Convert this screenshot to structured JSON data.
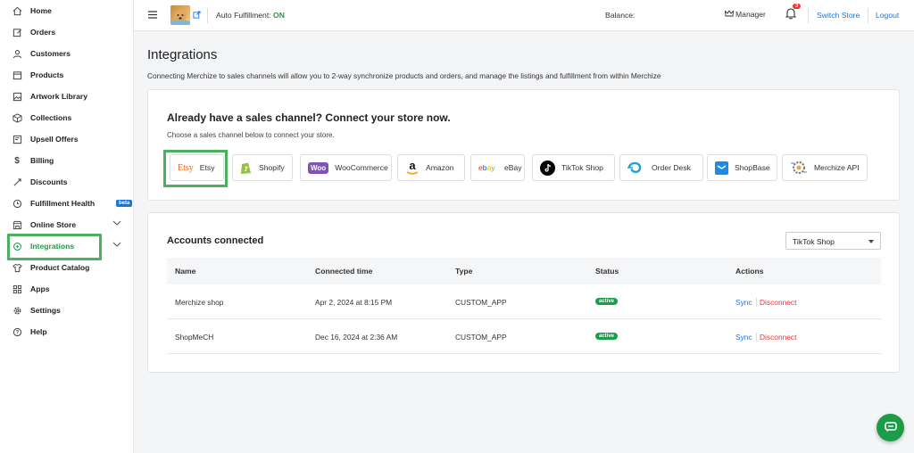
{
  "sidebar": {
    "items": [
      {
        "label": "Home",
        "icon": "home-icon"
      },
      {
        "label": "Orders",
        "icon": "edit-icon"
      },
      {
        "label": "Customers",
        "icon": "user-icon"
      },
      {
        "label": "Products",
        "icon": "box-icon"
      },
      {
        "label": "Artwork Library",
        "icon": "image-icon"
      },
      {
        "label": "Collections",
        "icon": "cube-icon"
      },
      {
        "label": "Upsell Offers",
        "icon": "offer-icon"
      },
      {
        "label": "Billing",
        "icon": "dollar-icon"
      },
      {
        "label": "Discounts",
        "icon": "tag-icon"
      },
      {
        "label": "Fulfillment Health",
        "icon": "clock-icon",
        "badge": "beta"
      },
      {
        "label": "Online Store",
        "icon": "store-icon"
      },
      {
        "label": "Integrations",
        "icon": "integration-icon"
      },
      {
        "label": "Product Catalog",
        "icon": "shirt-icon"
      },
      {
        "label": "Apps",
        "icon": "apps-icon"
      },
      {
        "label": "Settings",
        "icon": "gear-icon"
      },
      {
        "label": "Help",
        "icon": "help-icon"
      }
    ]
  },
  "header": {
    "auto_fulfillment_label": "Auto Fulfillment:",
    "auto_fulfillment_value": "ON",
    "balance_label": "Balance:",
    "manager_label": "Manager",
    "notification_count": "3",
    "switch_store": "Switch Store",
    "logout": "Logout"
  },
  "page": {
    "title": "Integrations",
    "description": "Connecting Merchize to sales channels will allow you to 2-way synchronize products and orders, and manage the listings and fulfillment from within Merchize"
  },
  "connect": {
    "title": "Already have a sales channel? Connect your store now.",
    "subtitle": "Choose a sales channel below to connect your store.",
    "channels": [
      {
        "label": "Etsy",
        "logo": "Etsy"
      },
      {
        "label": "Shopify"
      },
      {
        "label": "WooCommerce",
        "logo": "Woo"
      },
      {
        "label": "Amazon"
      },
      {
        "label": "eBay"
      },
      {
        "label": "TikTok Shop"
      },
      {
        "label": "Order Desk"
      },
      {
        "label": "ShopBase"
      },
      {
        "label": "Merchize API"
      }
    ]
  },
  "accounts": {
    "title": "Accounts connected",
    "filter_value": "TikTok Shop",
    "columns": {
      "name": "Name",
      "time": "Connected time",
      "type": "Type",
      "status": "Status",
      "actions": "Actions"
    },
    "rows": [
      {
        "name": "Merchize shop",
        "time": "Apr 2, 2024 at 8:15 PM",
        "type": "CUSTOM_APP",
        "status": "active",
        "sync": "Sync",
        "disconnect": "Disconnect"
      },
      {
        "name": "ShopMeCH",
        "time": "Dec 16, 2024 at 2:36 AM",
        "type": "CUSTOM_APP",
        "status": "active",
        "sync": "Sync",
        "disconnect": "Disconnect"
      }
    ]
  },
  "colors": {
    "accent": "#1e9b48",
    "link": "#1a73e8",
    "danger": "#e53935",
    "highlight": "#4cb063"
  }
}
